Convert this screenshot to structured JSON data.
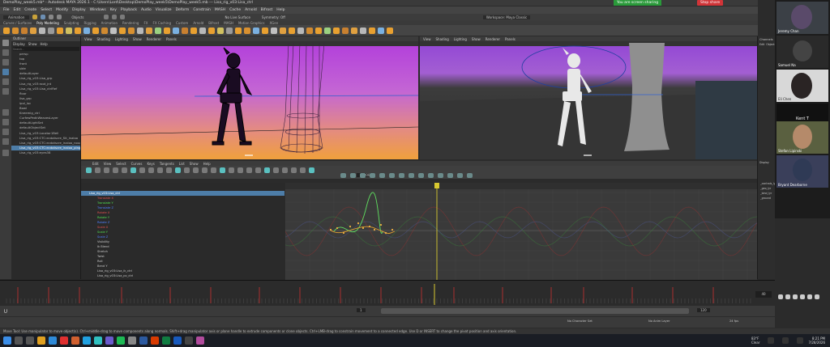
{
  "window": {
    "title": "DemoPlay_week5.mb* - Autodesk MAYA 2026.1 - C:\\Users\\Lord\\Desktop\\DemoPlay_week5\\DemoPlay_week5.mb --- Lisa_rig_v03:Lisa_ctrl"
  },
  "screenshare": {
    "sharing_label": "You are screen sharing",
    "stop_label": "Stop share"
  },
  "menubar": {
    "items": [
      "File",
      "Edit",
      "Create",
      "Select",
      "Modify",
      "Display",
      "Windows",
      "Key",
      "Playback",
      "Audio",
      "Visualize",
      "Deform",
      "Constrain",
      "MASH",
      "Cache",
      "Arnold",
      "Bifrost",
      "Help"
    ]
  },
  "statusline": {
    "mode": "Animation",
    "objects_label": "Objects",
    "surface_label": "No Live Surface",
    "symmetry_label": "Symmetry: Off",
    "workspace_label": "Workspace: Maya Classic"
  },
  "shelf": {
    "tabs": [
      "Curves / Surfaces",
      "Poly Modeling",
      "Sculpting",
      "Rigging",
      "Animation",
      "Rendering",
      "FX",
      "FX Caching",
      "Custom",
      "Arnold",
      "Bifrost",
      "MASH",
      "Motion Graphics",
      "XGen"
    ],
    "active_tab": "Poly Modeling"
  },
  "outliner": {
    "title": "Outliner",
    "menu": [
      "Display",
      "Show",
      "Help"
    ],
    "search_placeholder": "Search...",
    "rows": [
      "persp",
      "top",
      "front",
      "side",
      "defaultLayer",
      "Lisa_rig_v03:Lisa_grp",
      "Lisa_rig_v03:root_jnt",
      "Lisa_rig_v03:Lisa_ctrlRef",
      "floor",
      "lisa_grp",
      "ipol_loc",
      "Bowl",
      "Kneemig_ctrl",
      "CurfewPedkWeavesLayer",
      "defaultLightSet",
      "defaultObjectSet",
      "Lisa_rig_v03:Locator1Bell",
      "Lisa_rig_v03:CTC:ecdotscre_Sit_inaloo",
      "Lisa_rig_v03:CTC:ecdotscre_inaloo_noughfold",
      "Lisa_rig_v03:CTC:ecdotscre_inaloo_pingfold",
      "Lisa_rig_v03:eyes38"
    ],
    "selected_index": 19
  },
  "viewport_left": {
    "menu": [
      "View",
      "Shading",
      "Lighting",
      "Show",
      "Renderer",
      "Panels"
    ],
    "camera_label": "persp"
  },
  "viewport_right": {
    "menu": [
      "View",
      "Shading",
      "Lighting",
      "Show",
      "Renderer",
      "Panels"
    ],
    "camera_label": "persp"
  },
  "channelbox": {
    "title": "Channels",
    "items": [
      "Edit",
      "Object",
      "Show"
    ],
    "layers_title": "Display",
    "layers": [
      "_controls_lyr",
      "_geo_lyr",
      "_bind_lyr",
      "_ground"
    ]
  },
  "participants": [
    {
      "name": "Jeremy Chan"
    },
    {
      "name": "Samuel Na"
    },
    {
      "name": "Eli Chen"
    },
    {
      "name": "Kent T"
    },
    {
      "name": "Stefan Lipinski"
    },
    {
      "name": "Bryant Dearborne"
    }
  ],
  "graph_editor": {
    "menu": [
      "Edit",
      "View",
      "Select",
      "Curves",
      "Keys",
      "Tangents",
      "List",
      "Show",
      "Help"
    ],
    "stats": "0.000",
    "tree_root": "Lisa_rig_v03:Lisa_ctrl",
    "channels": [
      {
        "label": "Translate X",
        "color": "#e05050"
      },
      {
        "label": "Translate Y",
        "color": "#50e050"
      },
      {
        "label": "Translate Z",
        "color": "#5080ff"
      },
      {
        "label": "Rotate X",
        "color": "#e05050"
      },
      {
        "label": "Rotate Y",
        "color": "#50e050"
      },
      {
        "label": "Rotate Z",
        "color": "#5080ff"
      },
      {
        "label": "Scale X",
        "color": "#e05050"
      },
      {
        "label": "Scale Y",
        "color": "#50e050"
      },
      {
        "label": "Scale Z",
        "color": "#5080ff"
      },
      {
        "label": "Visibility",
        "color": "#c8c8c8"
      },
      {
        "label": "Ik Blend",
        "color": "#c8c8c8"
      },
      {
        "label": "Stretch",
        "color": "#c8c8c8"
      },
      {
        "label": "Twist",
        "color": "#c8c8c8"
      },
      {
        "label": "Roll",
        "color": "#c8c8c8"
      },
      {
        "label": "Bend Y",
        "color": "#c8c8c8"
      },
      {
        "label": "Lisa_rig_v03:Lisa_ik_ctrl",
        "color": "#c8c8c8"
      },
      {
        "label": "Lisa_rig_v03:Lisa_pv_ctrl",
        "color": "#c8c8c8"
      }
    ]
  },
  "playback": {
    "start_field": "1",
    "end_field": "120",
    "current_frame": "40",
    "char_set_label": "No Character Set",
    "anim_layer_label": "No Anim Layer",
    "fps_label": "24 fps"
  },
  "helpline": {
    "text": "Move Tool: Use manipulator to move object(s). Ctrl+middle-drag to move components along normals. Shift+drag manipulator axis or plane handle to extrude components or clone objects. Ctrl+LMB-drag to constrain movement to a connected edge. Use D or INSERT to change the pivot position and axis orientation."
  },
  "taskbar": {
    "weather_temp": "83°F",
    "weather_desc": "Clear",
    "time": "8:21 PM",
    "date": "7/28/2026"
  },
  "colors": {
    "accent_select": "#4d7da8",
    "timeline_marker": "#d8c830",
    "key_tick": "#b83030",
    "screenshare_green": "#2a9a3a",
    "stop_red": "#d13438"
  }
}
